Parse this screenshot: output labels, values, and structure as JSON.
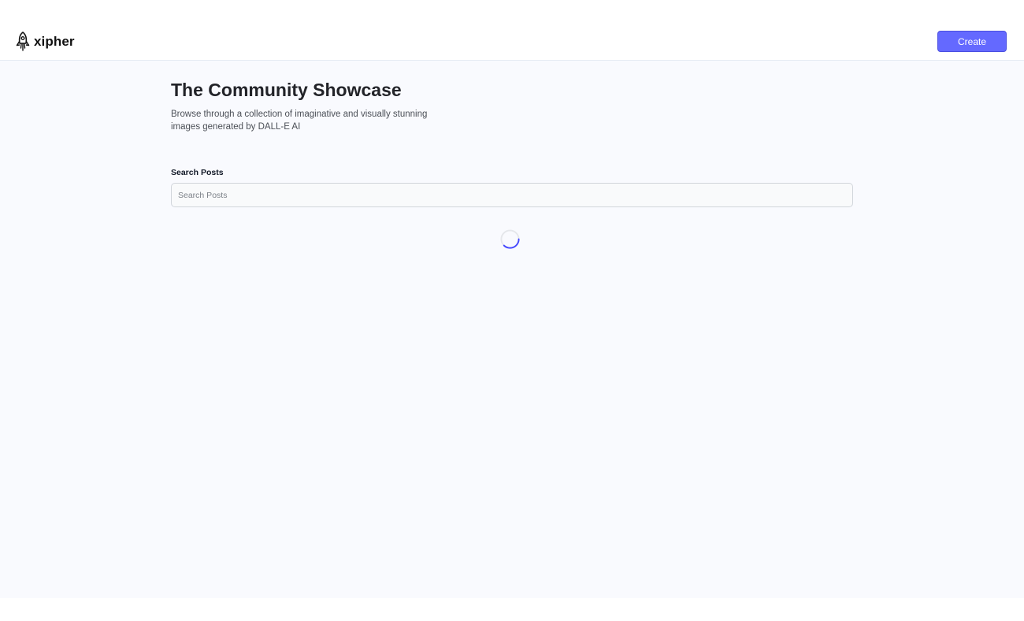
{
  "header": {
    "brand": "xipher",
    "logo_icon": "rocket-icon",
    "create_label": "Create"
  },
  "main": {
    "title": "The Community Showcase",
    "subtitle": "Browse through a collection of imaginative and visually stunning images generated by DALL-E AI",
    "search": {
      "label": "Search Posts",
      "placeholder": "Search Posts",
      "value": ""
    },
    "loader_icon": "loading-spinner-icon"
  },
  "colors": {
    "accent": "#6469ff",
    "page_bg": "#f9fafe",
    "spinner_track": "#e5e7eb",
    "spinner_arc": "#4649ff"
  }
}
